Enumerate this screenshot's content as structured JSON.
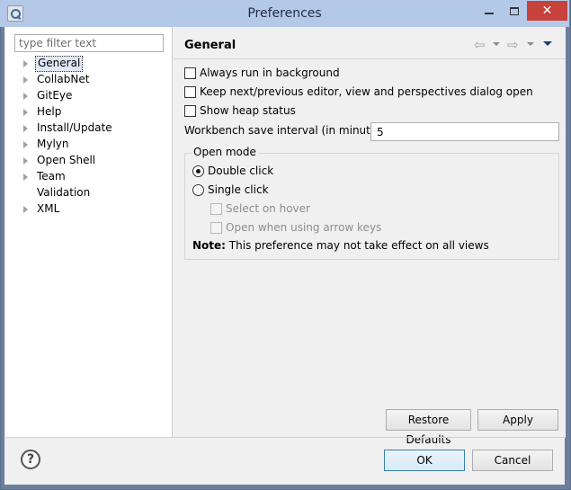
{
  "window": {
    "title": "Preferences"
  },
  "filter": {
    "placeholder": "type filter text"
  },
  "tree": [
    {
      "label": "General",
      "expandable": true,
      "selected": true
    },
    {
      "label": "CollabNet",
      "expandable": true
    },
    {
      "label": "GitEye",
      "expandable": true
    },
    {
      "label": "Help",
      "expandable": true
    },
    {
      "label": "Install/Update",
      "expandable": true
    },
    {
      "label": "Mylyn",
      "expandable": true
    },
    {
      "label": "Open Shell",
      "expandable": true
    },
    {
      "label": "Team",
      "expandable": true
    },
    {
      "label": "Validation",
      "expandable": false
    },
    {
      "label": "XML",
      "expandable": true
    }
  ],
  "page": {
    "title": "General",
    "options": {
      "always_run": "Always run in background",
      "keep_next": "Keep next/previous editor, view and perspectives dialog open",
      "show_heap": "Show heap status"
    },
    "interval": {
      "label": "Workbench save interval (in minutes):",
      "value": "5"
    },
    "open_mode": {
      "title": "Open mode",
      "double_click": "Double click",
      "single_click": "Single click",
      "select_on_hover": "Select on hover",
      "open_arrow_keys": "Open when using arrow keys",
      "note_label": "Note:",
      "note_text": "This preference may not take effect on all views"
    },
    "restore_defaults": "Restore Defaults",
    "apply": "Apply"
  },
  "footer": {
    "help": "?",
    "ok": "OK",
    "cancel": "Cancel"
  }
}
